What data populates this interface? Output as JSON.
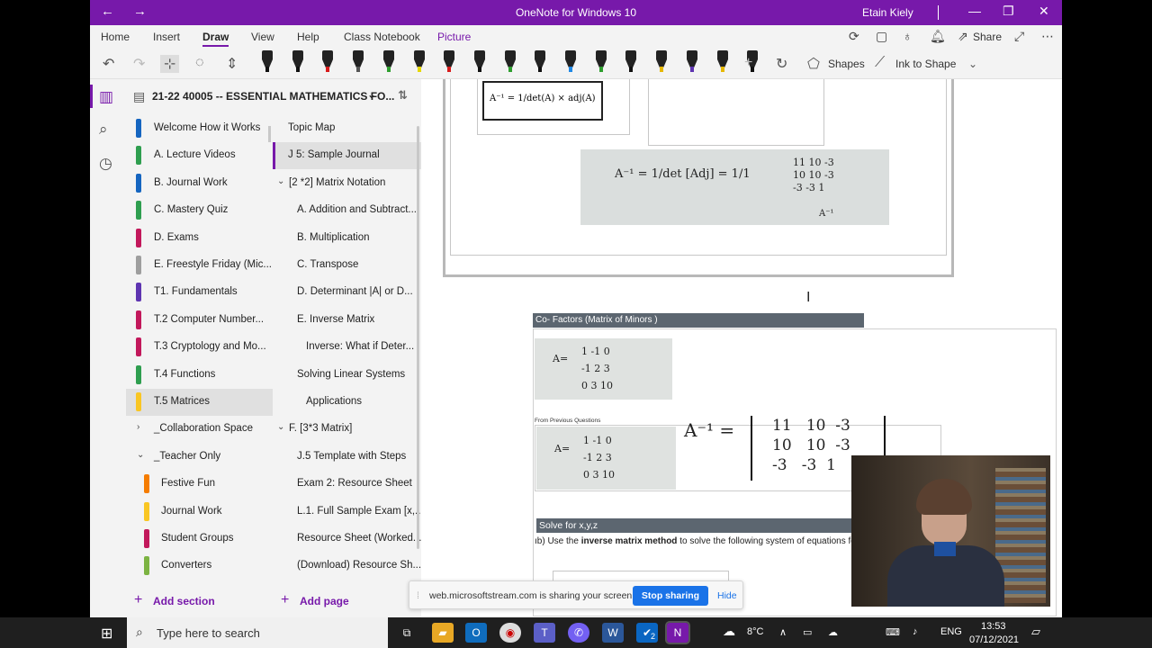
{
  "window": {
    "title": "OneNote for Windows 10",
    "user": "Etain Kiely",
    "back_icon": "back-arrow-icon",
    "forward_icon": "forward-arrow-icon",
    "minimize": "—",
    "maximize": "❐",
    "close": "✕"
  },
  "ribbon": {
    "tabs": [
      "Home",
      "Insert",
      "Draw",
      "View",
      "Help",
      "Class Notebook",
      "Picture"
    ],
    "active_tab": "Draw",
    "share_label": "Share",
    "shapes_label": "Shapes",
    "ink_to_shape_label": "Ink to Shape",
    "pen_colors": [
      "#111111",
      "#111111",
      "#d81b1b",
      "#555555",
      "#2e9e2e",
      "#e6d800",
      "#d81b1b",
      "#111111",
      "#2e9e2e",
      "#111111",
      "#1e88e5",
      "#2e9e2e",
      "#111111",
      "#e6b800",
      "#5e35b1",
      "#e6b800",
      "#111111"
    ]
  },
  "notebook": {
    "name": "21-22 40005 -- ESSENTIAL MATHEMATICS FO...",
    "add_section": "Add section",
    "add_page": "Add page"
  },
  "sections": [
    {
      "label": "Welcome How it Works",
      "color": "#1565c0"
    },
    {
      "label": "A. Lecture Videos",
      "color": "#2e9e4f"
    },
    {
      "label": "B. Journal Work",
      "color": "#1565c0"
    },
    {
      "label": "C. Mastery Quiz",
      "color": "#2e9e4f"
    },
    {
      "label": "D. Exams",
      "color": "#c2185b"
    },
    {
      "label": "E. Freestyle Friday (Mic...",
      "color": "#9e9e9e"
    },
    {
      "label": "T1. Fundamentals",
      "color": "#5e35b1"
    },
    {
      "label": "T.2 Computer Number...",
      "color": "#c2185b"
    },
    {
      "label": "T.3 Cryptology and Mo...",
      "color": "#c2185b"
    },
    {
      "label": "T.4 Functions",
      "color": "#2e9e4f"
    },
    {
      "label": "T.5 Matrices",
      "color": "#f9c623",
      "selected": true
    }
  ],
  "section_groups": [
    {
      "label": "_Collaboration Space",
      "expanded": false
    },
    {
      "label": "_Teacher Only",
      "expanded": true
    }
  ],
  "teacher_sections": [
    {
      "label": "Festive Fun",
      "color": "#f57c00"
    },
    {
      "label": "Journal Work",
      "color": "#f9c623"
    },
    {
      "label": "Student Groups",
      "color": "#c2185b"
    },
    {
      "label": "Converters",
      "color": "#7cb342"
    }
  ],
  "pages": [
    {
      "label": "Topic Map",
      "indent": 0
    },
    {
      "label": "J 5: Sample Journal",
      "indent": 0,
      "selected": true
    },
    {
      "label": "[2 *2] Matrix Notation",
      "indent": 0,
      "group": true
    },
    {
      "label": "A. Addition and Subtract...",
      "indent": 1
    },
    {
      "label": "B. Multiplication",
      "indent": 1
    },
    {
      "label": "C. Transpose",
      "indent": 1
    },
    {
      "label": "D. Determinant |A| or D...",
      "indent": 1
    },
    {
      "label": "E. Inverse Matrix",
      "indent": 1
    },
    {
      "label": "Inverse: What if Deter...",
      "indent": 2
    },
    {
      "label": "Solving Linear Systems",
      "indent": 1
    },
    {
      "label": "Applications",
      "indent": 2
    },
    {
      "label": "F. [3*3 Matrix]",
      "indent": 0,
      "group": true
    },
    {
      "label": "J.5 Template with Steps",
      "indent": 1
    },
    {
      "label": "Exam 2: Resource Sheet",
      "indent": 1
    },
    {
      "label": "L.1. Full Sample Exam [x,...",
      "indent": 1
    },
    {
      "label": "Resource Sheet (Worked...",
      "indent": 1
    },
    {
      "label": "(Download) Resource Sh...",
      "indent": 1
    }
  ],
  "canvas": {
    "formula_box": "A⁻¹ = 1/det(A) × adj(A)",
    "cofactor_bar": "Co- Factors (Matrix of Minors )",
    "from_previous": "From Previous Questions",
    "solve_bar": "Solve for x,y,z",
    "solve_prefix": "ıb) Use the ",
    "solve_bold": "inverse matrix method",
    "solve_suffix": " to solve the following system of equations for x, y and z.",
    "matrix_A_label": "A=",
    "matrix_A": [
      [
        "1",
        "-1",
        "0"
      ],
      [
        "-1",
        "2",
        "3"
      ],
      [
        "0",
        "3",
        "10"
      ]
    ],
    "inverse_label": "A⁻¹ =",
    "inverse": [
      [
        "11",
        "10",
        "-3"
      ],
      [
        "10",
        "10",
        "-3"
      ],
      [
        "-3",
        "-3",
        "1"
      ]
    ],
    "handwritten_adj": "A⁻¹ = 1/det [Adj] = 1/1",
    "handwritten_ainv": "A⁻¹"
  },
  "share_bar": {
    "message": "web.microsoftstream.com is sharing your screen.",
    "stop_label": "Stop sharing",
    "hide_label": "Hide"
  },
  "taskbar": {
    "search_placeholder": "Type here to search",
    "weather": "8°C",
    "language": "ENG",
    "time": "13:53",
    "date": "07/12/2021",
    "teams_badge": "2"
  }
}
